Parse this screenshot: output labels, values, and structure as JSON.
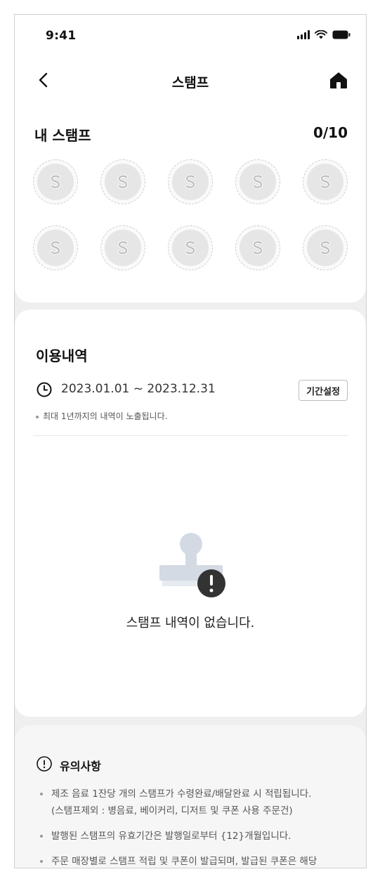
{
  "status_bar": {
    "time": "9:41"
  },
  "nav": {
    "title": "스탬프"
  },
  "stamps": {
    "title": "내 스탬프",
    "collected": "0",
    "total": "10",
    "count_label": "0/10",
    "slot_count": 10
  },
  "usage": {
    "title": "이용내역",
    "period": "2023.01.01 ~ 2023.12.31",
    "period_button": "기간설정",
    "note": "최대 1년까지의 내역이 노출됩니다.",
    "empty_message": "스탬프 내역이 없습니다."
  },
  "notice": {
    "title": "유의사항",
    "items": [
      "제조 음료 1잔당 개의 스탬프가 수령완료/배달완료 시 적립됩니다.\n(스탬프제외 : 병음료, 베이커리, 디저트 및 쿠폰 사용 주문건)",
      "발행된 스탬프의 유효기간은 발행일로부터 {12}개월입니다.",
      "주문 매장별로 스탬프 적립 및 쿠폰이 발급되며, 발급된 쿠폰은 해당"
    ]
  },
  "colors": {
    "background": "#efefef",
    "card": "#ffffff",
    "stamp_empty": "#e6e6e6",
    "stamp_border": "#cfcfcf",
    "illustration": "#d3dae3",
    "alert_dark": "#333333"
  },
  "icons": [
    "back-arrow-icon",
    "home-icon",
    "stamp-placeholder-icon",
    "clock-icon",
    "stamp-illustration-icon",
    "alert-icon",
    "info-circle-icon",
    "signal-icon",
    "wifi-icon",
    "battery-icon"
  ]
}
